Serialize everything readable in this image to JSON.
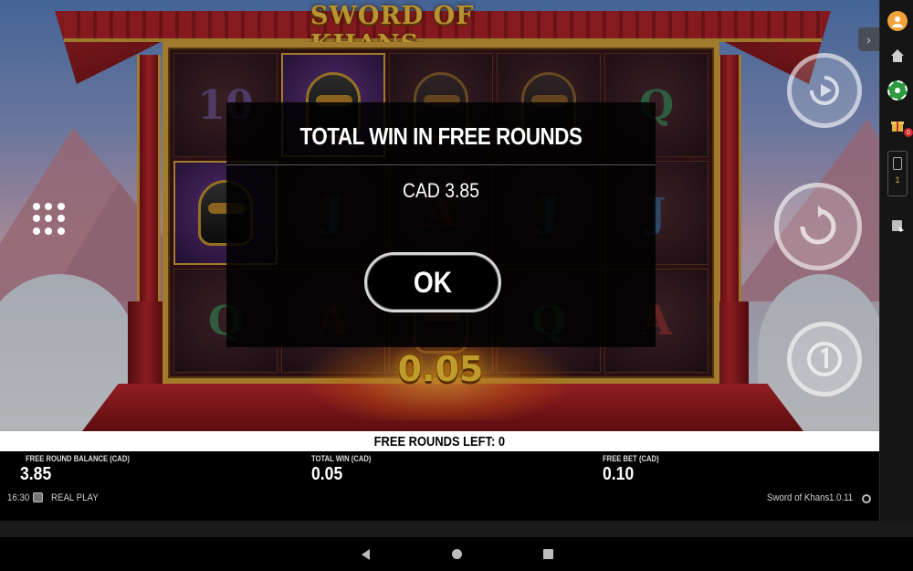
{
  "game": {
    "logo": "SWORD OF KHANS",
    "win_amount": "0.05",
    "reels": [
      [
        "10",
        "helmet",
        "warrior",
        "warrior",
        "Q"
      ],
      [
        "helmet",
        "J",
        "A",
        "J",
        "J"
      ],
      [
        "Q",
        "A",
        "warrior",
        "Q",
        "A"
      ]
    ]
  },
  "modal": {
    "title": "TOTAL WIN IN FREE ROUNDS",
    "amount": "CAD 3.85",
    "ok_label": "OK"
  },
  "free_rounds_bar": {
    "text": "FREE ROUNDS LEFT: 0"
  },
  "stats": {
    "balance": {
      "label": "FREE ROUND BALANCE (CAD)",
      "value": "3.85"
    },
    "total_win": {
      "label": "TOTAL WIN (CAD)",
      "value": "0.05"
    },
    "bet": {
      "label": "FREE BET (CAD)",
      "value": "0.10"
    }
  },
  "footer": {
    "clock": "16:30",
    "mode": "REAL PLAY",
    "game_name": "Sword of Khans",
    "version": "1.0.11"
  },
  "sidebar": {
    "gift_badge": "0",
    "slip_count": "1"
  },
  "colors": {
    "accent_gold": "#f4c542",
    "win_amount": "#ffcf3a",
    "chip_green": "#2e9b3e"
  },
  "icons": [
    "menu-icon",
    "autoplay-icon",
    "spin-icon",
    "bet-level-icon",
    "collapse-icon",
    "avatar-icon",
    "home-icon",
    "chip-icon",
    "gift-icon",
    "bet-slip-icon",
    "history-icon",
    "settings-icon",
    "back-icon",
    "home-nav-icon",
    "recents-icon"
  ]
}
